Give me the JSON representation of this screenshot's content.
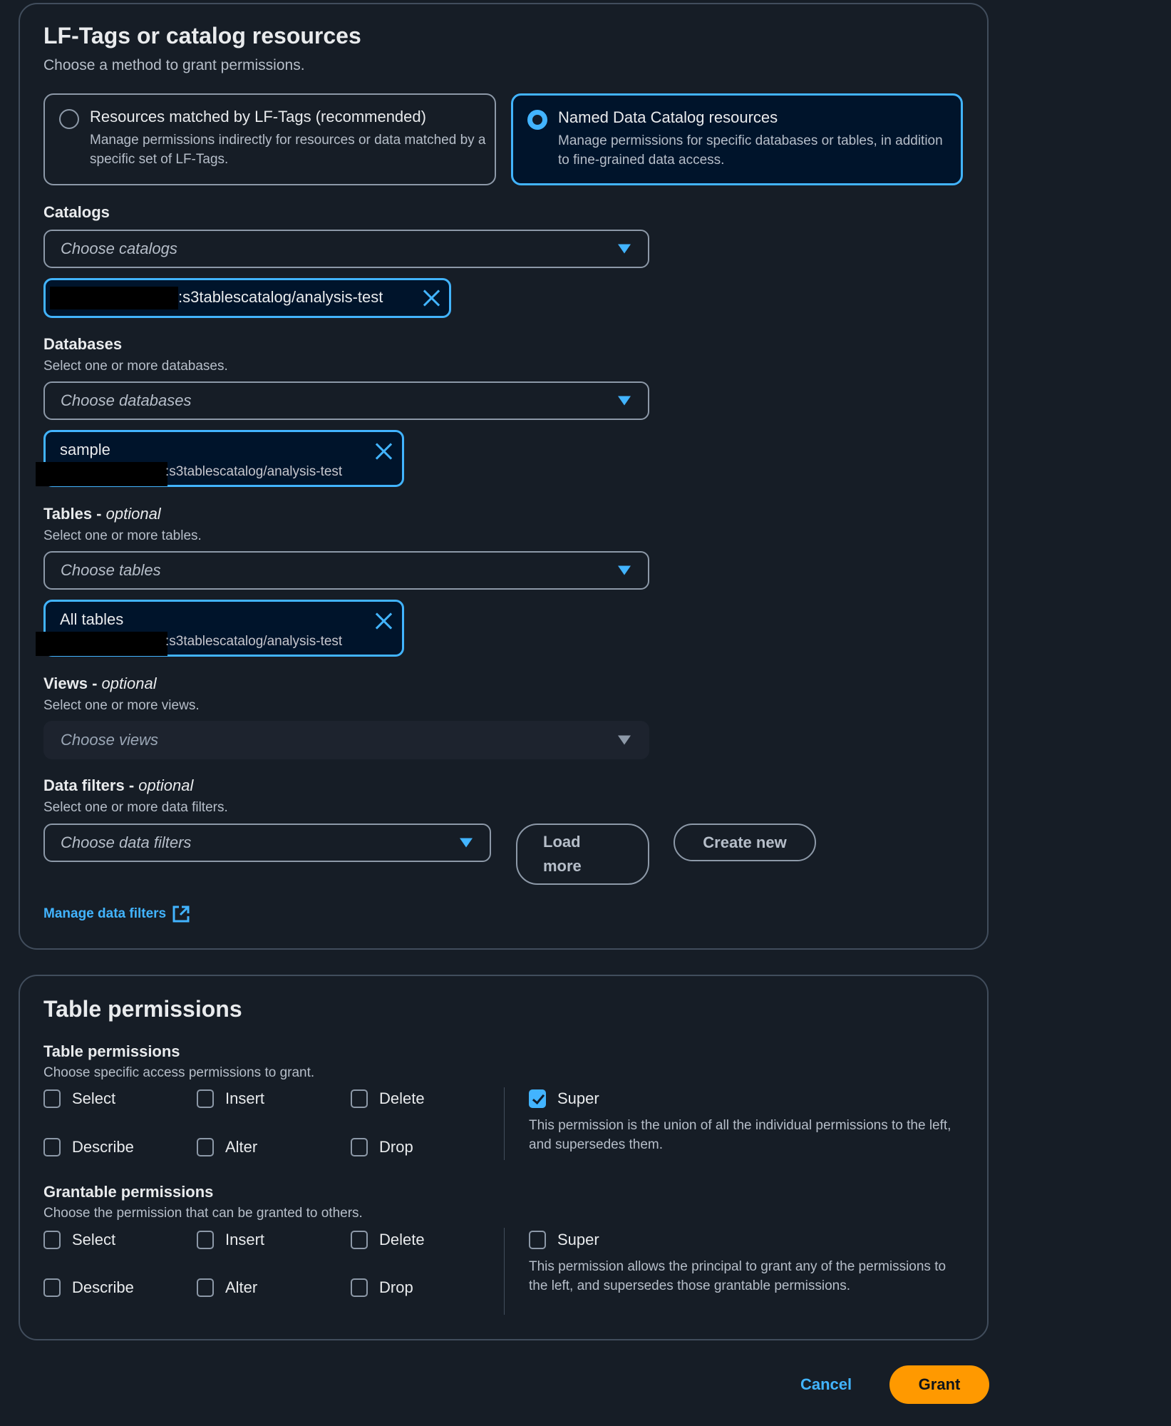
{
  "resources_panel": {
    "title": "LF-Tags or catalog resources",
    "description": "Choose a method to grant permissions.",
    "method_options": [
      {
        "title": "Resources matched by LF-Tags (recommended)",
        "description": "Manage permissions indirectly for resources or data matched by a specific set of LF-Tags.",
        "selected": false
      },
      {
        "title": "Named Data Catalog resources",
        "description": "Manage permissions for specific databases or tables, in addition to fine-grained data access.",
        "selected": true
      }
    ],
    "catalogs": {
      "label": "Catalogs",
      "placeholder": "Choose catalogs",
      "tokens": [
        {
          "name": ":s3tablescatalog/analysis-test"
        }
      ]
    },
    "databases": {
      "label": "Databases",
      "hint": "Select one or more databases.",
      "placeholder": "Choose databases",
      "tokens": [
        {
          "name": "sample",
          "subtitle": ":s3tablescatalog/analysis-test"
        }
      ]
    },
    "tables": {
      "label": "Tables",
      "optional": "optional",
      "hint": "Select one or more tables.",
      "placeholder": "Choose tables",
      "tokens": [
        {
          "name": "All tables",
          "subtitle": ":s3tablescatalog/analysis-test"
        }
      ]
    },
    "views": {
      "label": "Views",
      "optional": "optional",
      "hint": "Select one or more views.",
      "placeholder": "Choose views",
      "disabled": true
    },
    "data_filters": {
      "label": "Data filters",
      "optional": "optional",
      "hint": "Select one or more data filters.",
      "placeholder": "Choose data filters",
      "load_more": "Load more",
      "create_new": "Create new",
      "manage_link": "Manage data filters"
    }
  },
  "permissions_panel": {
    "title": "Table permissions",
    "table_permissions": {
      "label": "Table permissions",
      "hint": "Choose specific access permissions to grant.",
      "options": [
        {
          "label": "Select",
          "checked": false
        },
        {
          "label": "Insert",
          "checked": false
        },
        {
          "label": "Delete",
          "checked": false
        },
        {
          "label": "Describe",
          "checked": false
        },
        {
          "label": "Alter",
          "checked": false
        },
        {
          "label": "Drop",
          "checked": false
        }
      ],
      "super": {
        "label": "Super",
        "checked": true,
        "description": "This permission is the union of all the individual permissions to the left, and supersedes them."
      }
    },
    "grantable_permissions": {
      "label": "Grantable permissions",
      "hint": "Choose the permission that can be granted to others.",
      "options": [
        {
          "label": "Select",
          "checked": false
        },
        {
          "label": "Insert",
          "checked": false
        },
        {
          "label": "Delete",
          "checked": false
        },
        {
          "label": "Describe",
          "checked": false
        },
        {
          "label": "Alter",
          "checked": false
        },
        {
          "label": "Drop",
          "checked": false
        }
      ],
      "super": {
        "label": "Super",
        "checked": false,
        "description": "This permission allows the principal to grant any of the permissions to the left, and supersedes those grantable permissions."
      }
    }
  },
  "footer": {
    "cancel": "Cancel",
    "grant": "Grant"
  },
  "colors": {
    "accent": "#42b4ff",
    "primary_button": "#ff9900",
    "background": "#161d26"
  }
}
